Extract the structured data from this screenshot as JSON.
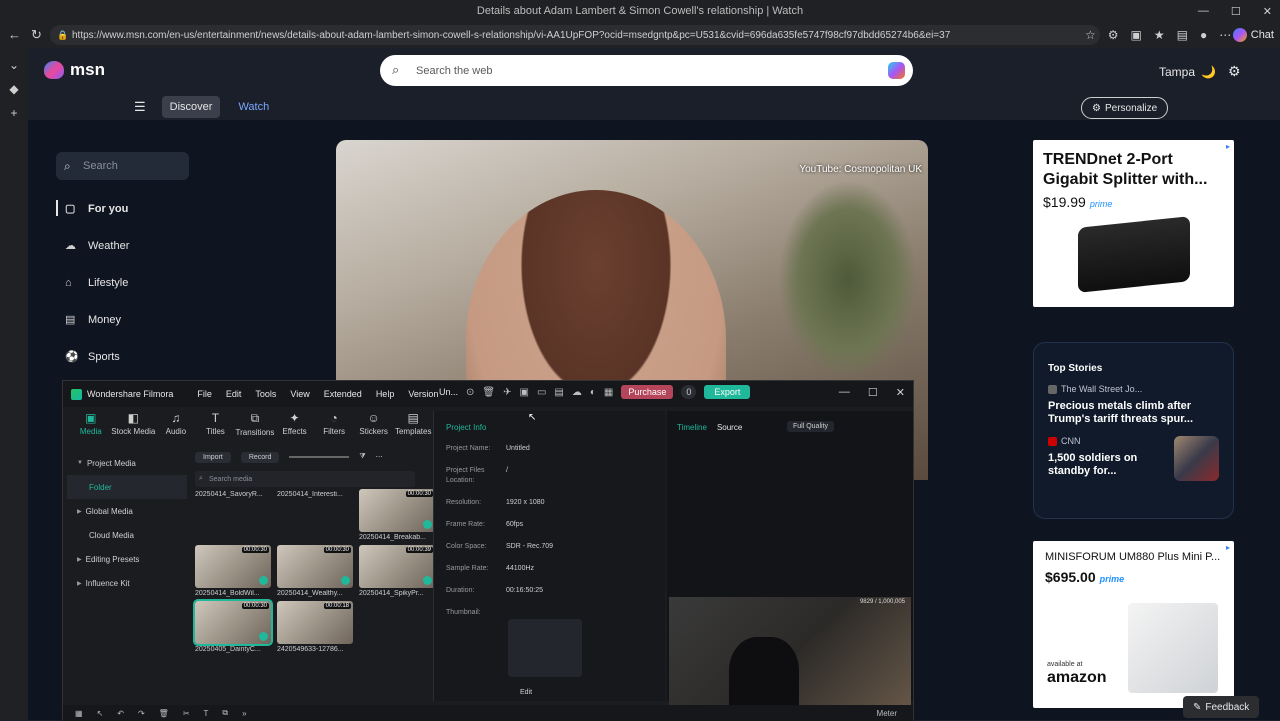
{
  "browser": {
    "window_title": "Details about Adam Lambert & Simon Cowell's relationship | Watch",
    "url": "https://www.msn.com/en-us/entertainment/news/details-about-adam-lambert-simon-cowell-s-relationship/vi-AA1UpFOP?ocid=msedgntp&pc=U531&cvid=696da635fe5747f98cf97dbdd65274b6&ei=37",
    "chat_label": "Chat"
  },
  "msn": {
    "logo_text": "msn",
    "search_placeholder": "Search the web",
    "city": "Tampa",
    "tabs": [
      "Discover",
      "Watch"
    ],
    "personalize": "Personalize",
    "sidebar_search_placeholder": "Search",
    "nav": [
      "For you",
      "Weather",
      "Lifestyle",
      "Money",
      "Sports"
    ],
    "video_credit": "YouTube: Cosmopolitan UK",
    "ad1": {
      "title": "TRENDnet 2-Port Gigabit Splitter with...",
      "price": "$19.99",
      "prime": "prime"
    },
    "top_stories": {
      "header": "Top Stories",
      "items": [
        {
          "source": "The Wall Street Jo...",
          "headline": "Precious metals climb after Trump's tariff threats spur..."
        },
        {
          "source": "CNN",
          "headline": "1,500 soldiers on standby for..."
        }
      ]
    },
    "ad2": {
      "title": "MINISFORUM UM880 Plus Mini P...",
      "price": "$695.00",
      "prime": "prime",
      "available": "available at",
      "store": "amazon"
    },
    "feedback": "Feedback"
  },
  "filmora": {
    "app_name": "Wondershare Filmora",
    "menus": [
      "File",
      "Edit",
      "Tools",
      "View",
      "Extended",
      "Help",
      "Version"
    ],
    "project_short": "Un...",
    "purchase": "Purchase",
    "count": "0",
    "export": "Export",
    "tools": [
      "Media",
      "Stock Media",
      "Audio",
      "Titles",
      "Transitions",
      "Effects",
      "Filters",
      "Stickers",
      "Templates"
    ],
    "tree": [
      "Project Media",
      "Folder",
      "Global Media",
      "Cloud Media",
      "Editing Presets",
      "Influence Kit"
    ],
    "import": "Import",
    "record": "Record",
    "media_search": "Search media",
    "top_names": [
      "20250414_SavoryR...",
      "20250414_Interesti..."
    ],
    "media": [
      {
        "name": "20250414_Breakab...",
        "dur": "00:00:30"
      },
      {
        "name": "20250414_BoldWil...",
        "dur": "00:00:30"
      },
      {
        "name": "20250414_Wealthy...",
        "dur": "00:00:30"
      },
      {
        "name": "20250414_SpikyPr...",
        "dur": "00:00:39"
      },
      {
        "name": "20250405_DaintyC...",
        "dur": "00:00:30"
      },
      {
        "name": "2420549633-12786...",
        "dur": "00:00:18"
      }
    ],
    "info": {
      "header": "Project Info",
      "rows": [
        {
          "k": "Project Name:",
          "v": "Untitled"
        },
        {
          "k": "Project Files Location:",
          "v": "/"
        },
        {
          "k": "Resolution:",
          "v": "1920 x 1080"
        },
        {
          "k": "Frame Rate:",
          "v": "60fps"
        },
        {
          "k": "Color Space:",
          "v": "SDR - Rec.709"
        },
        {
          "k": "Sample Rate:",
          "v": "44100Hz"
        },
        {
          "k": "Duration:",
          "v": "00:16:50:25"
        },
        {
          "k": "Thumbnail:",
          "v": ""
        }
      ],
      "edit": "Edit"
    },
    "preview": {
      "tab_timeline": "Timeline",
      "tab_source": "Source",
      "quality": "Full Quality",
      "counter": "9829 / 1,000,005"
    },
    "bottom_meter": "Meter"
  }
}
